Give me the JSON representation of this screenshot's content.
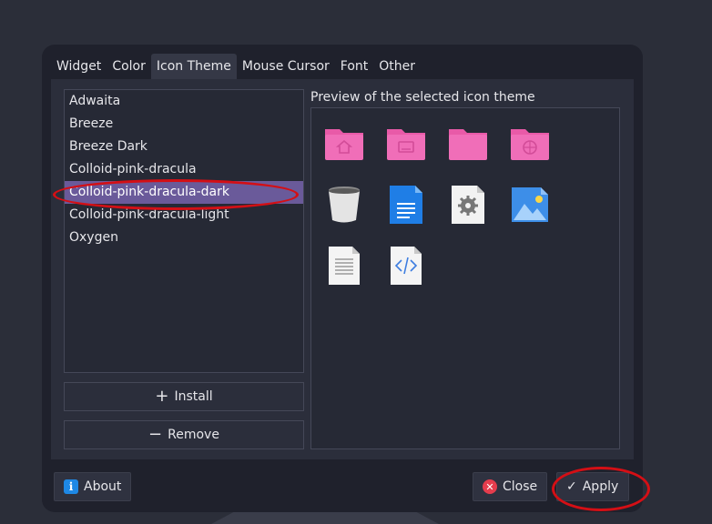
{
  "tabs": [
    {
      "label": "Widget"
    },
    {
      "label": "Color"
    },
    {
      "label": "Icon Theme",
      "active": true
    },
    {
      "label": "Mouse Cursor"
    },
    {
      "label": "Font"
    },
    {
      "label": "Other"
    }
  ],
  "theme_list": {
    "items": [
      "Adwaita",
      "Breeze",
      "Breeze Dark",
      "Colloid-pink-dracula",
      "Colloid-pink-dracula-dark",
      "Colloid-pink-dracula-light",
      "Oxygen"
    ],
    "selected": "Colloid-pink-dracula-dark"
  },
  "buttons": {
    "install": "Install",
    "remove": "Remove",
    "about": "About",
    "close": "Close",
    "apply": "Apply"
  },
  "preview": {
    "label": "Preview of the selected icon theme",
    "icons": [
      "folder-home-icon",
      "folder-desktop-icon",
      "folder-icon",
      "folder-network-icon",
      "trash-icon",
      "text-document-icon",
      "settings-file-icon",
      "image-file-icon",
      "plain-text-file-icon",
      "code-file-icon"
    ]
  },
  "colors": {
    "accent_pink": "#f06eb8",
    "selection": "#6a5a9a",
    "annotation_red": "#d40f15",
    "window_bg": "#1f212c"
  }
}
